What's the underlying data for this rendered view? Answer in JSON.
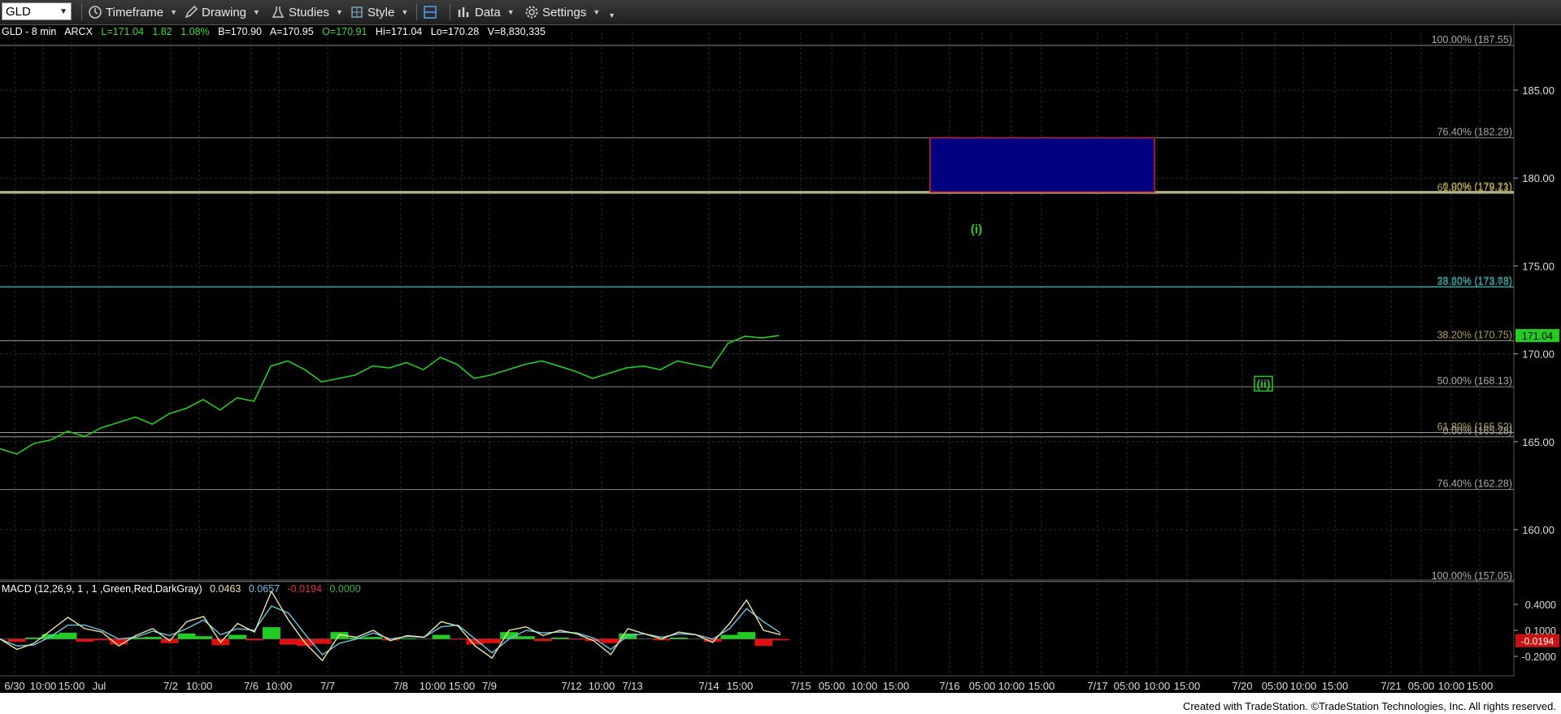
{
  "toolbar": {
    "symbol": "GLD",
    "timeframe_label": "Timeframe",
    "drawing_label": "Drawing",
    "studies_label": "Studies",
    "style_label": "Style",
    "data_label": "Data",
    "settings_label": "Settings"
  },
  "infobar": {
    "symbol_interval": "GLD - 8 min",
    "exchange": "ARCX",
    "last": "L=171.04",
    "change": "1.82",
    "change_pct": "1.08%",
    "bid": "B=170.90",
    "ask": "A=170.95",
    "open": "O=170.91",
    "high": "Hi=171.04",
    "low": "Lo=170.28",
    "volume": "V=8,830,335"
  },
  "macd_label": {
    "name": "MACD (12,26,9, 1 , 1 ,Green,Red,DarkGray)",
    "macd": "0.0463",
    "signal": "0.0657",
    "diff": "-0.0194",
    "zero": "0.0000"
  },
  "footer": "Created with TradeStation. ©TradeStation Technologies, Inc. All rights reserved.",
  "colors": {
    "price": "#22cc22",
    "grid": "#2b2b2b",
    "macd_line": "#e8e8a0",
    "signal_line": "#6cc6e6",
    "macd_pos": "#22cc22",
    "macd_neg": "#e01010",
    "target_box": "#000080",
    "target_border": "#cc2222"
  },
  "chart_data": {
    "type": "line",
    "price_axis": {
      "ticks": [
        "185.00",
        "180.00",
        "175.00",
        "170.00",
        "165.00",
        "160.00"
      ],
      "tick_values": [
        185,
        180,
        175,
        170,
        165,
        160
      ],
      "last_price_label": "171.04",
      "last_price": 171.04
    },
    "time_axis": {
      "labels": [
        "6/30",
        "10:00",
        "15:00",
        "Jul",
        "7/2",
        "10:00",
        "7/6",
        "10:00",
        "7/7",
        "7/8",
        "10:00",
        "15:00",
        "7/9",
        "7/12",
        "10:00",
        "7/13",
        "7/14",
        "15:00",
        "7/15",
        "05:00",
        "10:00",
        "15:00",
        "7/16",
        "05:00",
        "10:00",
        "15:00",
        "7/17",
        "05:00",
        "10:00",
        "15:00",
        "7/20",
        "05:00",
        "10:00",
        "15:00",
        "7/21",
        "05:00",
        "10:00",
        "15:00"
      ]
    },
    "price_series": {
      "name": "GLD",
      "values": [
        164.6,
        164.3,
        164.9,
        165.1,
        165.6,
        165.3,
        165.8,
        166.1,
        166.4,
        166.0,
        166.6,
        166.9,
        167.4,
        166.8,
        167.5,
        167.3,
        169.3,
        169.6,
        169.1,
        168.4,
        168.6,
        168.8,
        169.3,
        169.2,
        169.5,
        169.1,
        169.8,
        169.4,
        168.6,
        168.8,
        169.1,
        169.4,
        169.6,
        169.3,
        169.0,
        168.6,
        168.9,
        169.2,
        169.3,
        169.1,
        169.6,
        169.4,
        169.2,
        170.6,
        171.0,
        170.9,
        171.04
      ]
    },
    "fib_levels": [
      {
        "label": "100.00% (187.55)",
        "value": 187.55
      },
      {
        "label": "76.40% (182.29)",
        "value": 182.29
      },
      {
        "label": "0.00% (179.21)",
        "value": 179.21
      },
      {
        "label": "61.80% (179.13)",
        "value": 179.13
      },
      {
        "label": "23.60% (173.83)",
        "value": 173.83
      },
      {
        "label": "38.20% (173.78)",
        "value": 173.78
      },
      {
        "label": "38.20% (170.75)",
        "value": 170.75
      },
      {
        "label": "50.00% (168.13)",
        "value": 168.13
      },
      {
        "label": "61.80% (165.52)",
        "value": 165.52
      },
      {
        "label": "0.00% (165.28)",
        "value": 165.28
      },
      {
        "label": "76.40% (162.28)",
        "value": 162.28
      },
      {
        "label": "100.00% (157.05)",
        "value": 157.05
      }
    ],
    "target_box": {
      "top": 182.29,
      "bottom": 179.21,
      "start": "7/16",
      "end": "7/17 10:00"
    },
    "wave_labels": [
      {
        "text": "(i)",
        "value": 177.1,
        "time": "7/16 05:00"
      },
      {
        "text": "(ii)",
        "value": 168.3,
        "time": "7/20 05:00"
      }
    ],
    "macd_axis": {
      "ticks": [
        "0.4000",
        "0.1000",
        "-0.2000"
      ],
      "tick_values": [
        0.4,
        0.1,
        -0.2
      ],
      "last_label": "-0.0194",
      "last_value": -0.0194
    },
    "macd_series": {
      "macd": [
        0,
        -0.12,
        -0.05,
        0.1,
        0.25,
        0.12,
        0.08,
        -0.08,
        0.04,
        0.12,
        -0.02,
        0.2,
        0.26,
        -0.04,
        0.18,
        0.08,
        0.55,
        0.22,
        -0.05,
        -0.25,
        0.05,
        0.02,
        0.1,
        -0.02,
        0.04,
        0.02,
        0.2,
        0.15,
        -0.08,
        -0.22,
        0.1,
        0.14,
        0.04,
        0.1,
        0.06,
        -0.02,
        -0.18,
        0.12,
        0.06,
        0.0,
        0.08,
        0.05,
        -0.04,
        0.18,
        0.45,
        0.1,
        0.05
      ],
      "signal": [
        0,
        -0.08,
        -0.07,
        0.03,
        0.16,
        0.16,
        0.1,
        0.0,
        0.02,
        0.09,
        0.04,
        0.12,
        0.22,
        0.05,
        0.12,
        0.1,
        0.38,
        0.3,
        0.05,
        -0.18,
        -0.05,
        0.0,
        0.07,
        0.0,
        0.03,
        0.02,
        0.14,
        0.16,
        0.0,
        -0.16,
        0.0,
        0.1,
        0.07,
        0.08,
        0.07,
        0.01,
        -0.12,
        0.04,
        0.06,
        0.02,
        0.06,
        0.05,
        0.0,
        0.12,
        0.35,
        0.2,
        0.07
      ]
    }
  }
}
